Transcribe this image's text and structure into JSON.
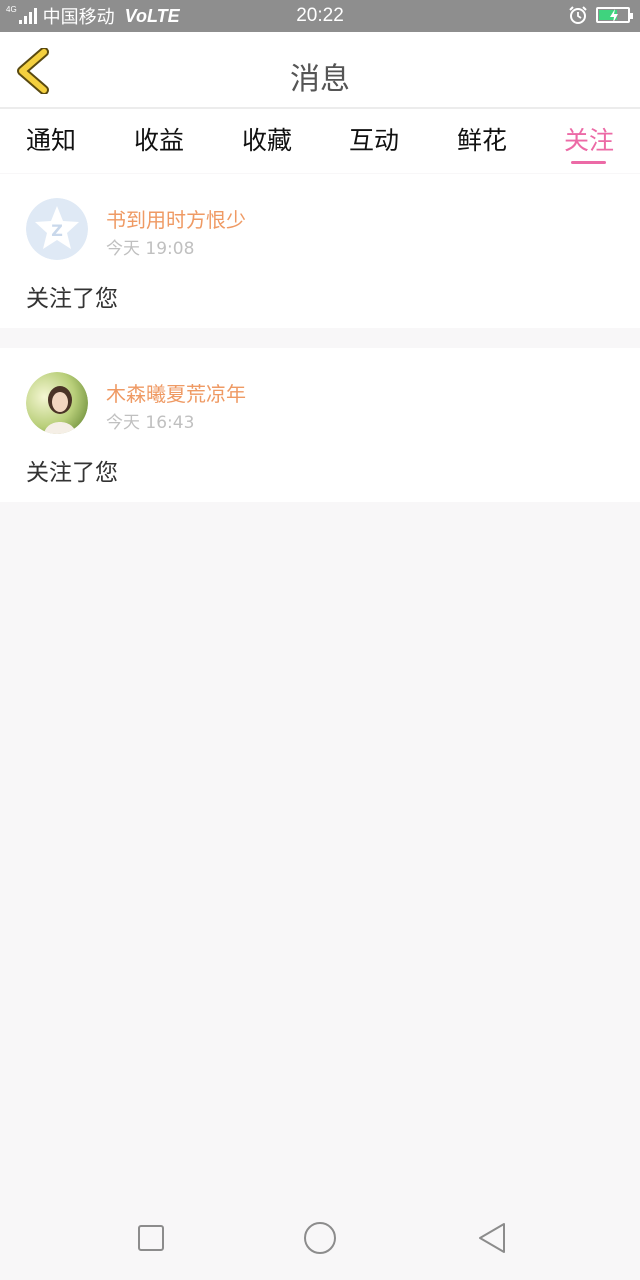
{
  "status_bar": {
    "network_type": "4G",
    "carrier": "中国移动",
    "volte": "VoLTE",
    "time": "20:22",
    "battery_color": "#3fd37e",
    "icons": [
      "signal-icon",
      "alarm-icon",
      "battery-charging-icon"
    ]
  },
  "header": {
    "title": "消息",
    "back_icon": "chevron-left-icon",
    "back_color": "#f4d03f"
  },
  "tabs": [
    {
      "label": "通知",
      "active": false
    },
    {
      "label": "收益",
      "active": false
    },
    {
      "label": "收藏",
      "active": false
    },
    {
      "label": "互动",
      "active": false
    },
    {
      "label": "鲜花",
      "active": false
    },
    {
      "label": "关注",
      "active": true
    }
  ],
  "accent_color": "#ec6aa6",
  "messages": [
    {
      "username": "书到用时方恨少",
      "time": "今天 19:08",
      "text": "关注了您",
      "avatar": "default-star-avatar"
    },
    {
      "username": "木森曦夏荒凉年",
      "time": "今天 16:43",
      "text": "关注了您",
      "avatar": "photo-avatar"
    }
  ],
  "nav_bar": {
    "icons": [
      "square-recents-icon",
      "circle-home-icon",
      "triangle-back-icon"
    ]
  }
}
